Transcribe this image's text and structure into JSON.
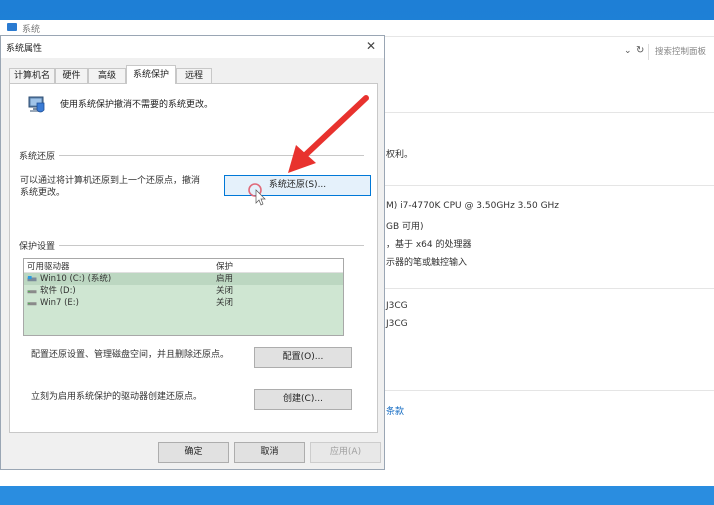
{
  "background_window": {
    "title": "系统",
    "search_placeholder": "搜索控制面板",
    "lines": [
      "权利。",
      "M) i7-4770K CPU @ 3.50GHz   3.50 GHz",
      "GB 可用)",
      "，基于 x64 的处理器",
      "示器的笔或触控输入",
      "J3CG",
      "J3CG"
    ],
    "link": "条款"
  },
  "dialog": {
    "title": "系统属性",
    "tabs": [
      {
        "label": "计算机名"
      },
      {
        "label": "硬件"
      },
      {
        "label": "高级"
      },
      {
        "label": "系统保护",
        "active": true
      },
      {
        "label": "远程"
      }
    ],
    "intro": "使用系统保护撤消不需要的系统更改。",
    "restore_group": "系统还原",
    "restore_desc_line1": "可以通过将计算机还原到上一个还原点，撤消",
    "restore_desc_line2": "系统更改。",
    "restore_button": "系统还原(S)...",
    "protection_group": "保护设置",
    "table": {
      "headers": [
        "可用驱动器",
        "保护"
      ],
      "rows": [
        {
          "drive": "Win10 (C:) (系统)",
          "protection": "启用"
        },
        {
          "drive": "软件 (D:)",
          "protection": "关闭"
        },
        {
          "drive": "Win7 (E:)",
          "protection": "关闭"
        }
      ]
    },
    "configure_text": "配置还原设置、管理磁盘空间，并且删除还原点。",
    "configure_button": "配置(O)...",
    "create_text": "立刻为启用系统保护的驱动器创建还原点。",
    "create_button": "创建(C)...",
    "ok_button": "确定",
    "cancel_button": "取消",
    "apply_button": "应用(A)"
  },
  "colors": {
    "accent": "#0078d7",
    "annotation_arrow": "#e8322e",
    "selection": "#cfe6d2"
  }
}
